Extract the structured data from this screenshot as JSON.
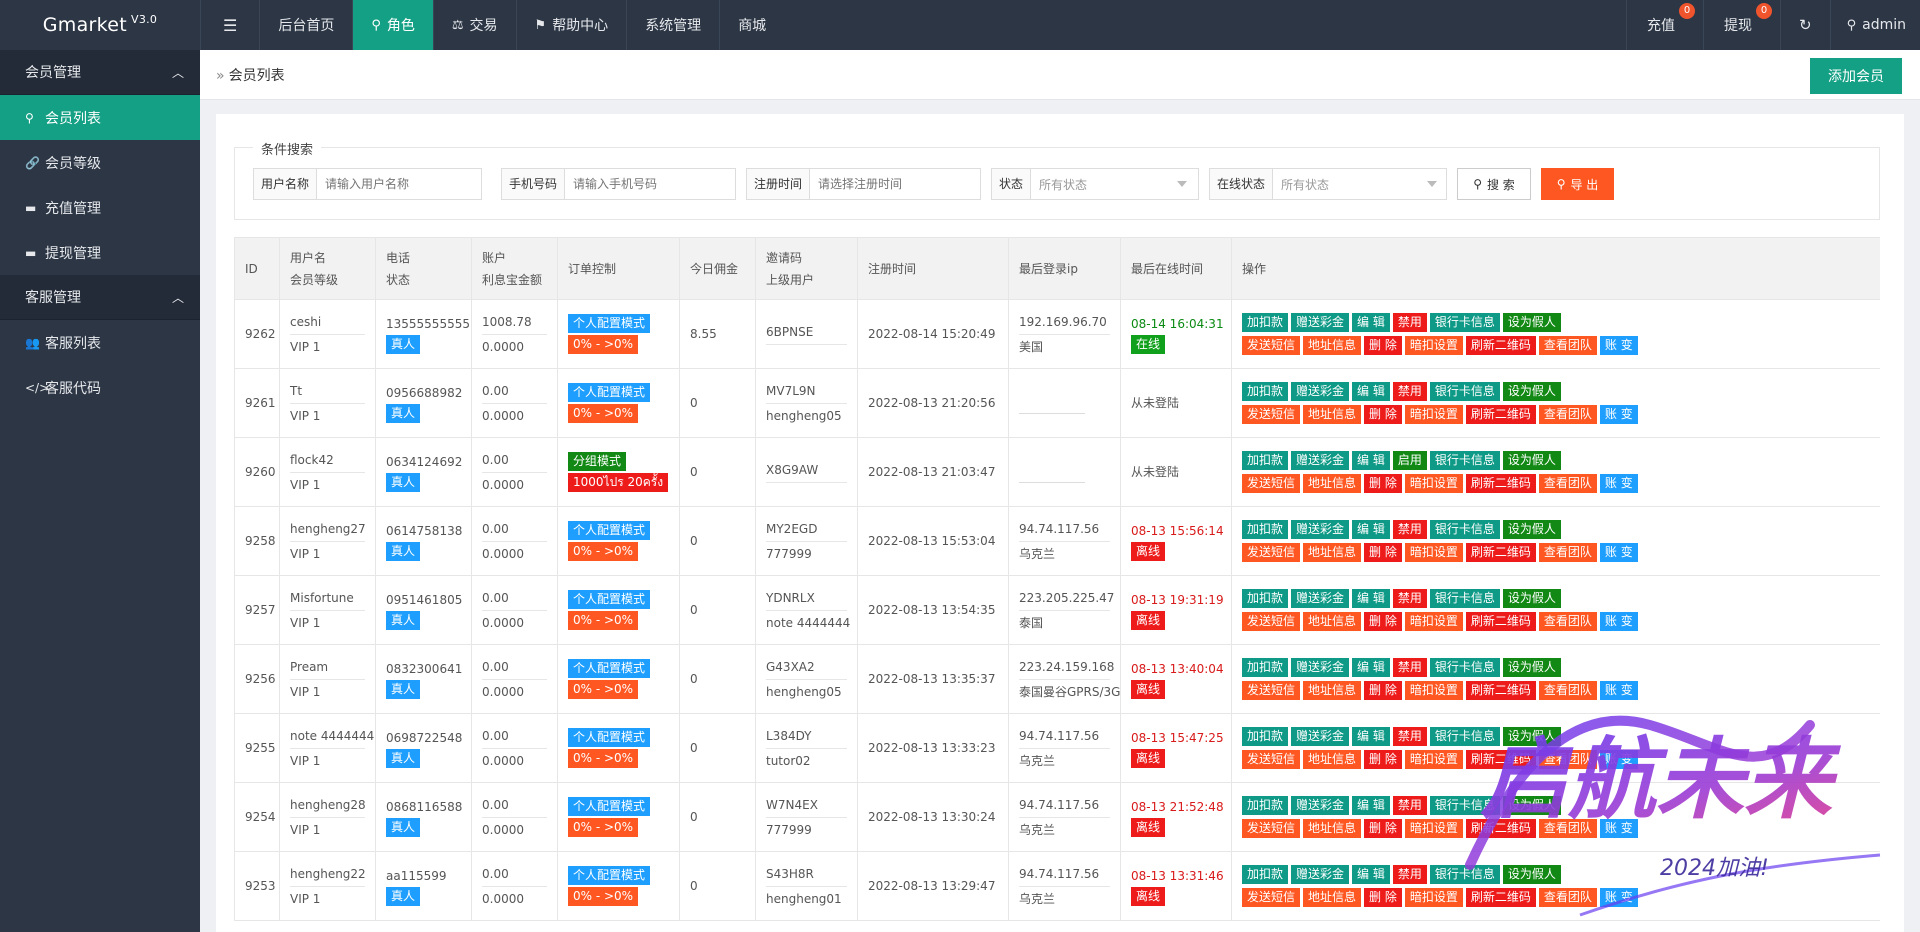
{
  "app": {
    "name": "Gmarket",
    "version": "V3.0"
  },
  "topnav": {
    "items": [
      "后台首页",
      "角色",
      "交易",
      "帮助中心",
      "系统管理",
      "商城"
    ],
    "recharge": "充值",
    "recharge_badge": "0",
    "withdraw": "提现",
    "withdraw_badge": "0",
    "user": "admin"
  },
  "sidebar": {
    "group1": "会员管理",
    "item_list": "会员列表",
    "item_level": "会员等级",
    "item_recharge": "充值管理",
    "item_withdraw": "提现管理",
    "group2": "客服管理",
    "item_cs_list": "客服列表",
    "item_cs_code": "客服代码"
  },
  "breadcrumb": "会员列表",
  "add_button": "添加会员",
  "filters": {
    "legend": "条件搜索",
    "username_label": "用户名称",
    "username_placeholder": "请输入用户名称",
    "phone_label": "手机号码",
    "phone_placeholder": "请输入手机号码",
    "regtime_label": "注册时间",
    "regtime_placeholder": "请选择注册时间",
    "status_label": "状态",
    "status_value": "所有状态",
    "online_label": "在线状态",
    "online_value": "所有状态",
    "search_button": "搜 索",
    "export_button": "导 出"
  },
  "columns": {
    "id": "ID",
    "user1": "用户名",
    "user2": "会员等级",
    "phone1": "电话",
    "phone2": "状态",
    "acc1": "账户",
    "acc2": "利息宝金额",
    "order": "订单控制",
    "commission": "今日佣金",
    "invite1": "邀请码",
    "invite2": "上级用户",
    "reg": "注册时间",
    "ip": "最后登录ip",
    "online": "最后在线时间",
    "ops": "操作"
  },
  "ops": {
    "add_deduct": "加扣款",
    "gift": "赠送彩金",
    "edit": "编 辑",
    "ban": "禁用",
    "enable": "启用",
    "bank": "银行卡信息",
    "fake": "设为假人",
    "sms": "发送短信",
    "address": "地址信息",
    "delete": "删 除",
    "deduct_set": "暗扣设置",
    "qrcode": "刷新二维码",
    "team": "查看团队",
    "account": "账 变"
  },
  "rows": [
    {
      "id": "9262",
      "name": "ceshi",
      "level": "VIP 1",
      "phone": "13555555555",
      "status": "真人",
      "balance": "1008.78",
      "interest": "0.0000",
      "mode": "个人配置模式",
      "range": "0% - >0%",
      "commission": "8.55",
      "code": "6BPNSE",
      "parent": "",
      "reg": "2022-08-14 15:20:49",
      "ip": "192.169.96.70",
      "region": "美国",
      "last": "08-14 16:04:31",
      "online": "在线"
    },
    {
      "id": "9261",
      "name": "Tt",
      "level": "VIP 1",
      "phone": "0956688982",
      "status": "真人",
      "balance": "0.00",
      "interest": "0.0000",
      "mode": "个人配置模式",
      "range": "0% - >0%",
      "commission": "0",
      "code": "MV7L9N",
      "parent": "hengheng05",
      "reg": "2022-08-13 21:20:56",
      "ip": "",
      "region": "",
      "last": "",
      "online": "从未登陆"
    },
    {
      "id": "9260",
      "name": "flock42",
      "level": "VIP 1",
      "phone": "0634124692",
      "status": "真人",
      "balance": "0.00",
      "interest": "0.0000",
      "mode": "分组模式",
      "range": "1000ไปร 20ครั้ง",
      "commission": "0",
      "code": "X8G9AW",
      "parent": "",
      "reg": "2022-08-13 21:03:47",
      "ip": "",
      "region": "",
      "last": "",
      "online": "从未登陆"
    },
    {
      "id": "9258",
      "name": "hengheng27",
      "level": "VIP 1",
      "phone": "0614758138",
      "status": "真人",
      "balance": "0.00",
      "interest": "0.0000",
      "mode": "个人配置模式",
      "range": "0% - >0%",
      "commission": "0",
      "code": "MY2EGD",
      "parent": "777999",
      "reg": "2022-08-13 15:53:04",
      "ip": "94.74.117.56",
      "region": "乌克兰",
      "last": "08-13 15:56:14",
      "online": "离线"
    },
    {
      "id": "9257",
      "name": "Misfortune",
      "level": "VIP 1",
      "phone": "0951461805",
      "status": "真人",
      "balance": "0.00",
      "interest": "0.0000",
      "mode": "个人配置模式",
      "range": "0% - >0%",
      "commission": "0",
      "code": "YDNRLX",
      "parent": "note 4444444",
      "reg": "2022-08-13 13:54:35",
      "ip": "223.205.225.47",
      "region": "泰国",
      "last": "08-13 19:31:19",
      "online": "离线"
    },
    {
      "id": "9256",
      "name": "Pream",
      "level": "VIP 1",
      "phone": "0832300641",
      "status": "真人",
      "balance": "0.00",
      "interest": "0.0000",
      "mode": "个人配置模式",
      "range": "0% - >0%",
      "commission": "0",
      "code": "G43XA2",
      "parent": "hengheng05",
      "reg": "2022-08-13 13:35:37",
      "ip": "223.24.159.168",
      "region": "泰国曼谷GPRS/3G",
      "last": "08-13 13:40:04",
      "online": "离线"
    },
    {
      "id": "9255",
      "name": "note 4444444",
      "level": "VIP 1",
      "phone": "0698722548",
      "status": "真人",
      "balance": "0.00",
      "interest": "0.0000",
      "mode": "个人配置模式",
      "range": "0% - >0%",
      "commission": "0",
      "code": "L384DY",
      "parent": "tutor02",
      "reg": "2022-08-13 13:33:23",
      "ip": "94.74.117.56",
      "region": "乌克兰",
      "last": "08-13 15:47:25",
      "online": "离线"
    },
    {
      "id": "9254",
      "name": "hengheng28",
      "level": "VIP 1",
      "phone": "0868116588",
      "status": "真人",
      "balance": "0.00",
      "interest": "0.0000",
      "mode": "个人配置模式",
      "range": "0% - >0%",
      "commission": "0",
      "code": "W7N4EX",
      "parent": "777999",
      "reg": "2022-08-13 13:30:24",
      "ip": "94.74.117.56",
      "region": "乌克兰",
      "last": "08-13 21:52:48",
      "online": "离线"
    },
    {
      "id": "9253",
      "name": "hengheng22",
      "level": "VIP 1",
      "phone": "aa115599",
      "status": "真人",
      "balance": "0.00",
      "interest": "0.0000",
      "mode": "个人配置模式",
      "range": "0% - >0%",
      "commission": "0",
      "code": "S43H8R",
      "parent": "hengheng01",
      "reg": "2022-08-13 13:29:47",
      "ip": "94.74.117.56",
      "region": "乌克兰",
      "last": "08-13 13:31:46",
      "online": "离线"
    }
  ],
  "watermark": {
    "text": "启航未来",
    "subtext": "2024加油!"
  },
  "colors": {
    "accent": "#14a085",
    "topbar": "#2c3645",
    "danger": "#ee1b1b",
    "info": "#1e9fff",
    "warn": "#ff5722"
  }
}
